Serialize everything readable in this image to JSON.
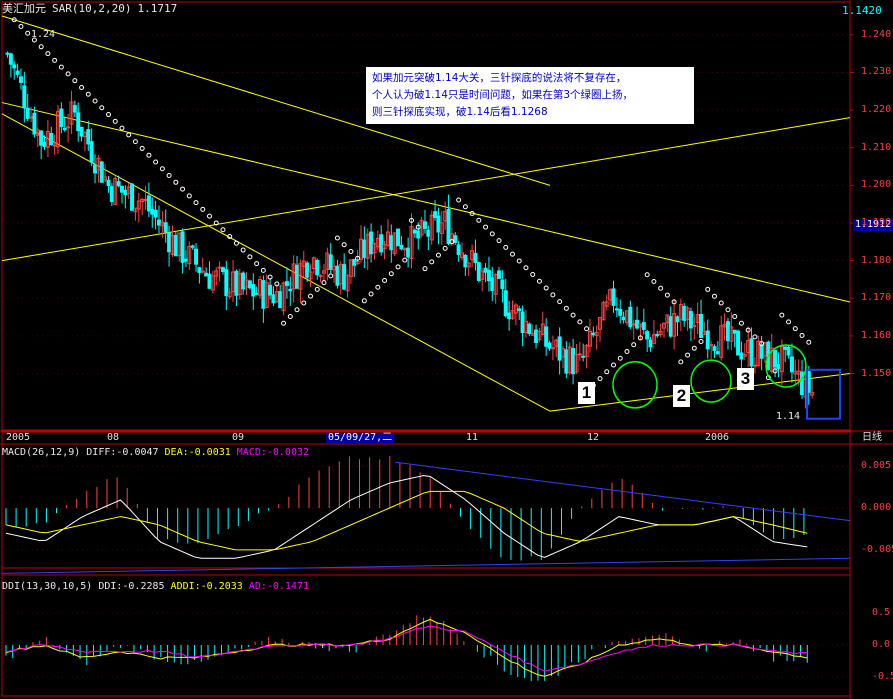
{
  "header": {
    "symbol": "美汇加元",
    "indicator": "SAR(10,2,20)",
    "indicator_value": "1.1717",
    "right_value": "1.1420"
  },
  "annotations": {
    "note_lines": [
      "如果加元突破1.14大关，三针探底的说法将不复存在，",
      "个人认为破1.14只是时间问题，如果在第3个绿圈上扬，",
      "则三针探底实现，破1.14后看1.1268"
    ],
    "label_1": "1",
    "label_2": "2",
    "label_3": "3",
    "peak_label": "1.24",
    "low_label": "1.14",
    "current_price": "1.1912"
  },
  "xaxis": {
    "labels": [
      "2005",
      "08",
      "09",
      "05/09/27,二",
      "11",
      "12",
      "2006"
    ],
    "period": "日线"
  },
  "macd_panel": {
    "name": "MACD(26,12,9)",
    "diff": "DIFF:-0.0047",
    "dea": "DEA:-0.0031",
    "macd": "MACD:-0.0032"
  },
  "ddi_panel": {
    "name": "DDI(13,30,10,5)",
    "ddi": "DDI:-0.2285",
    "addi": "ADDI:-0.2033",
    "ad": "AD:-0.1471"
  },
  "chart_data": [
    {
      "type": "candlestick",
      "title": "美汇加元",
      "ylim": [
        1.135,
        1.245
      ],
      "y_ticks": [
        "1.240",
        "1.230",
        "1.220",
        "1.210",
        "1.200",
        "1.190",
        "1.180",
        "1.170",
        "1.160",
        "1.150"
      ],
      "colors": {
        "up": "#ff4040",
        "down": "#00ffff",
        "sar": "#ffffff",
        "channel": "#ffff00",
        "circle": "#00ff00"
      },
      "series": [
        {
          "name": "close",
          "x": [
            0,
            10,
            20,
            30,
            40,
            50,
            60,
            70,
            80,
            90,
            100,
            110,
            120,
            130,
            140,
            150,
            160,
            170,
            180,
            190,
            200,
            210,
            220,
            230,
            239
          ],
          "values": [
            1.235,
            1.212,
            1.219,
            1.2,
            1.196,
            1.184,
            1.176,
            1.172,
            1.171,
            1.181,
            1.176,
            1.187,
            1.185,
            1.19,
            1.177,
            1.167,
            1.158,
            1.152,
            1.17,
            1.159,
            1.165,
            1.16,
            1.156,
            1.153,
            1.145
          ]
        }
      ]
    },
    {
      "type": "bar",
      "title": "MACD(26,12,9)",
      "ylim": [
        -0.008,
        0.006
      ],
      "y_ticks": [
        "0.005",
        "0.000",
        "-0.005"
      ],
      "series": [
        {
          "name": "DIFF",
          "values": [
            -0.003,
            -0.004,
            -0.001,
            0.001,
            -0.004,
            -0.006,
            -0.006,
            -0.005,
            -0.002,
            0.001,
            0.003,
            0.004,
            0.001,
            -0.003,
            -0.006,
            -0.004,
            -0.001,
            -0.002,
            -0.002,
            -0.001,
            -0.004,
            -0.0047
          ]
        },
        {
          "name": "DEA",
          "values": [
            -0.002,
            -0.003,
            -0.002,
            -0.001,
            -0.002,
            -0.004,
            -0.005,
            -0.005,
            -0.004,
            -0.002,
            0.0,
            0.002,
            0.002,
            0.0,
            -0.003,
            -0.004,
            -0.003,
            -0.002,
            -0.002,
            -0.001,
            -0.002,
            -0.0031
          ]
        }
      ]
    },
    {
      "type": "line",
      "title": "DDI(13,30,10,5)",
      "ylim": [
        -0.8,
        0.8
      ],
      "y_ticks": [
        "0.5",
        "0.0",
        "-0.5"
      ],
      "series": [
        {
          "name": "DDI",
          "values": [
            -0.2,
            0.1,
            -0.3,
            0.0,
            -0.2,
            -0.3,
            -0.1,
            0.1,
            0.0,
            -0.1,
            0.2,
            0.5,
            0.1,
            -0.4,
            -0.6,
            -0.2,
            0.1,
            0.2,
            -0.1,
            0.1,
            -0.2,
            -0.2285
          ]
        },
        {
          "name": "ADDI",
          "values": [
            -0.1,
            0.0,
            -0.2,
            -0.1,
            -0.2,
            -0.2,
            -0.1,
            0.0,
            0.0,
            0.0,
            0.1,
            0.4,
            0.2,
            -0.2,
            -0.5,
            -0.3,
            0.0,
            0.1,
            0.0,
            0.0,
            -0.1,
            -0.2033
          ]
        },
        {
          "name": "AD",
          "values": [
            -0.1,
            0.0,
            -0.1,
            -0.1,
            -0.1,
            -0.2,
            -0.1,
            0.0,
            0.0,
            0.0,
            0.1,
            0.3,
            0.2,
            -0.1,
            -0.4,
            -0.3,
            -0.1,
            0.0,
            0.0,
            0.0,
            -0.1,
            -0.1471
          ]
        }
      ]
    }
  ]
}
